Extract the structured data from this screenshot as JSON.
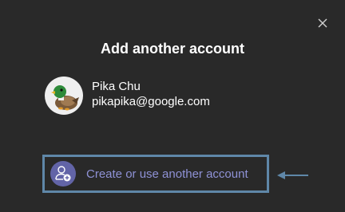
{
  "dialog": {
    "title": "Add another account",
    "close_icon": "close-icon"
  },
  "account": {
    "name": "Pika Chu",
    "email": "pikapika@google.com",
    "avatar_icon": "duck-avatar"
  },
  "create_account": {
    "label": "Create or use another account",
    "icon": "add-person-icon"
  },
  "annotation": {
    "arrow_icon": "arrow-left-icon"
  },
  "colors": {
    "background": "#292929",
    "accent": "#6264a7",
    "link_text": "#8f92d6",
    "highlight_border": "#5f87a8"
  }
}
